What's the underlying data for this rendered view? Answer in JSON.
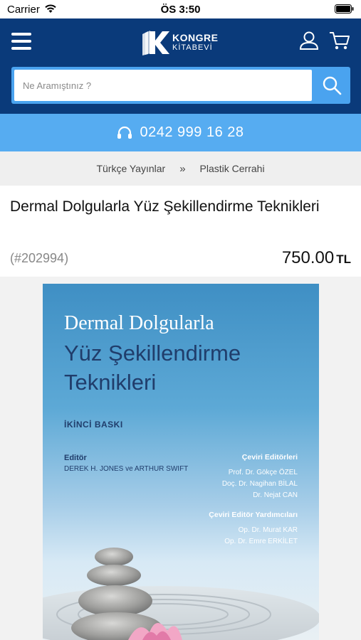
{
  "status_bar": {
    "carrier": "Carrier",
    "time": "ÖS 3:50"
  },
  "header": {
    "logo_line1": "KONGRE",
    "logo_line2": "KİTABEVİ",
    "brand_color": "#0a3a7a",
    "accent_color": "#4aa3ef"
  },
  "search": {
    "placeholder": "Ne Aramıştınız ?"
  },
  "phone_band": {
    "number": "0242 999 16 28"
  },
  "breadcrumb": {
    "items": [
      "Türkçe Yayınlar",
      "Plastik Cerrahi"
    ],
    "separator": "»"
  },
  "product": {
    "title": "Dermal Dolgularla Yüz Şekillendirme Teknikleri",
    "code": "(#202994)",
    "price": "750.00",
    "currency": "TL"
  },
  "cover": {
    "title_line1": "Dermal Dolgularla",
    "title_line2": "Yüz Şekillendirme",
    "title_line3": "Teknikleri",
    "edition": "İKİNCİ BASKI",
    "editor_label": "Editör",
    "editor_names": "DEREK H. JONES ve ARTHUR SWIFT",
    "translation_editors_label": "Çeviri Editörleri",
    "translation_editors": [
      "Prof. Dr. Gökçe ÖZEL",
      "Doç. Dr. Nagihan BİLAL",
      "Dr. Nejat CAN"
    ],
    "assistant_editors_label": "Çeviri Editör Yardımcıları",
    "assistant_editors": [
      "Op. Dr. Murat KAR",
      "Op. Dr. Emre ERKİLET"
    ]
  }
}
